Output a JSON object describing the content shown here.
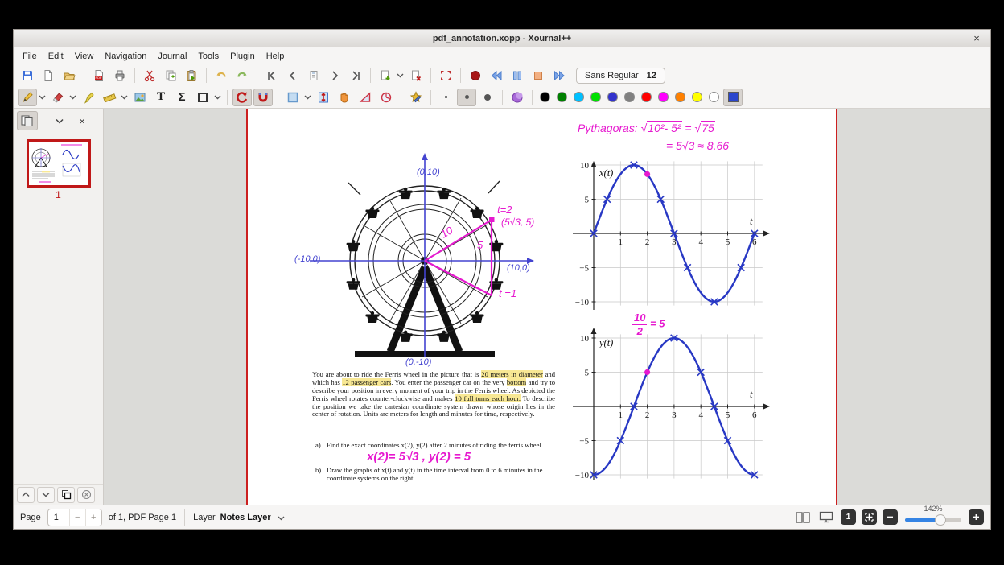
{
  "window": {
    "title": "pdf_annotation.xopp - Xournal++",
    "close_glyph": "×"
  },
  "menu": {
    "items": [
      "File",
      "Edit",
      "View",
      "Navigation",
      "Journal",
      "Tools",
      "Plugin",
      "Help"
    ]
  },
  "toolbar": {
    "font_name": "Sans Regular",
    "font_size": "12",
    "text_tool_glyph": "T",
    "tex_tool_glyph": "Σ",
    "pen_colors": [
      "#000000",
      "#008000",
      "#00c0ff",
      "#00e000",
      "#3333cc",
      "#808080",
      "#ff0000",
      "#ff00ff",
      "#ff8000",
      "#ffff00",
      "#ffffff"
    ]
  },
  "sidebar": {
    "page_thumb_number": "1"
  },
  "statusbar": {
    "page_label": "Page",
    "page_value": "1",
    "minus_glyph": "−",
    "plus_glyph": "+",
    "of_text": "of 1, PDF Page 1",
    "layer_label": "Layer",
    "layer_value": "Notes Layer",
    "one_page_glyph": "1",
    "zoom_percent": "142%"
  },
  "colors": {
    "accent_magenta": "#e619cf",
    "ink_blue": "#4343d0",
    "curve_blue": "#2838c4",
    "highlight_yellow": "#f8e894",
    "page_border_red": "#cc2020"
  },
  "annotations": {
    "pythagoras_label": "Pythagoras:",
    "pythagoras_radicand1": "10²- 5²",
    "pythagoras_eq": "=",
    "pythagoras_radical_sign": "√",
    "pythagoras_radicand2": "75",
    "pythagoras_line2": "= 5√3 ≈ 8.66",
    "answer_a": "x(2)= 5√3 , y(2) = 5",
    "fraction_numerator": "10",
    "fraction_denominator": "2",
    "fraction_rhs": "= 5"
  },
  "wheel_labels": {
    "top": "(0,10)",
    "left": "(-10,0)",
    "right": "(10,0)",
    "bottom": "(0,-10)",
    "t2": "t=2",
    "coords": "(5√3, 5)",
    "radius": "10",
    "height": "5",
    "t1": "t =1"
  },
  "document": {
    "paragraph": [
      {
        "t": "You are about to ride the Ferris wheel in the picture that is "
      },
      {
        "t": "20 meters in diameter",
        "hl": true
      },
      {
        "t": " and which has "
      },
      {
        "t": "12 passenger cars",
        "hl": true
      },
      {
        "t": ". You enter the passenger car on the very "
      },
      {
        "t": "bottom",
        "hl": true
      },
      {
        "t": " and try to describe your position in every moment of your trip in the Ferris wheel. As depicted the Ferris wheel rotates counter-clockwise and makes "
      },
      {
        "t": "10 full turns each hour.",
        "hl": true
      },
      {
        "t": " To describe the position we take the cartesian coordinate system drawn whose origin lies in the center of rotation. Units are meters for length and minutes for time, respectively."
      }
    ],
    "item_a_label": "a)",
    "item_a_text": "Find the exact coordinates x(2), y(2) after 2 minutes of riding the ferris wheel.",
    "item_b_label": "b)",
    "item_b_text": "Draw the graphs of x(t) and y(t) in the time interval from 0 to 6 minutes in the coordinate systems on the right."
  },
  "chart_data": [
    {
      "type": "line",
      "id": "xt",
      "title": "x(t)",
      "xlabel": "t",
      "xlim": [
        0,
        6.35
      ],
      "ylim": [
        -10.8,
        10.8
      ],
      "grid": true,
      "x_ticks": [
        1,
        2,
        3,
        4,
        5,
        6
      ],
      "x_tick_labels": [
        "1",
        "2",
        "3",
        "4",
        "5",
        "6"
      ],
      "y_ticks": [
        10,
        5,
        -5,
        -10
      ],
      "y_tick_labels": [
        "10",
        "5",
        "−5",
        "−10"
      ],
      "function": {
        "kind": "sin",
        "amplitude": 10,
        "period": 6
      },
      "curve_color": "#2838c4",
      "hand_marks": [
        [
          0,
          0
        ],
        [
          0.5,
          5
        ],
        [
          1.5,
          10
        ],
        [
          2.5,
          5
        ],
        [
          3,
          0
        ],
        [
          3.5,
          -5
        ],
        [
          4.5,
          -10
        ],
        [
          5.5,
          -5
        ],
        [
          6,
          0
        ]
      ],
      "highlight_point": {
        "t": 2,
        "value": 8.66,
        "color": "#e619cf"
      }
    },
    {
      "type": "line",
      "id": "yt",
      "title": "y(t)",
      "xlabel": "t",
      "xlim": [
        0,
        6.35
      ],
      "ylim": [
        -10.8,
        10.8
      ],
      "grid": true,
      "x_ticks": [
        1,
        2,
        3,
        4,
        5,
        6
      ],
      "x_tick_labels": [
        "1",
        "2",
        "3",
        "4",
        "5",
        "6"
      ],
      "y_ticks": [
        10,
        5,
        -5,
        -10
      ],
      "y_tick_labels": [
        "10",
        "5",
        "−5",
        "−10"
      ],
      "function": {
        "kind": "neg-cos",
        "amplitude": 10,
        "period": 6
      },
      "curve_color": "#2838c4",
      "hand_marks": [
        [
          0,
          -10
        ],
        [
          1,
          -5
        ],
        [
          1.5,
          0
        ],
        [
          3,
          10
        ],
        [
          4,
          5
        ],
        [
          4.5,
          0
        ],
        [
          5,
          -5
        ],
        [
          6,
          -10
        ]
      ],
      "highlight_point": {
        "t": 2,
        "value": 5,
        "color": "#e619cf"
      }
    }
  ]
}
